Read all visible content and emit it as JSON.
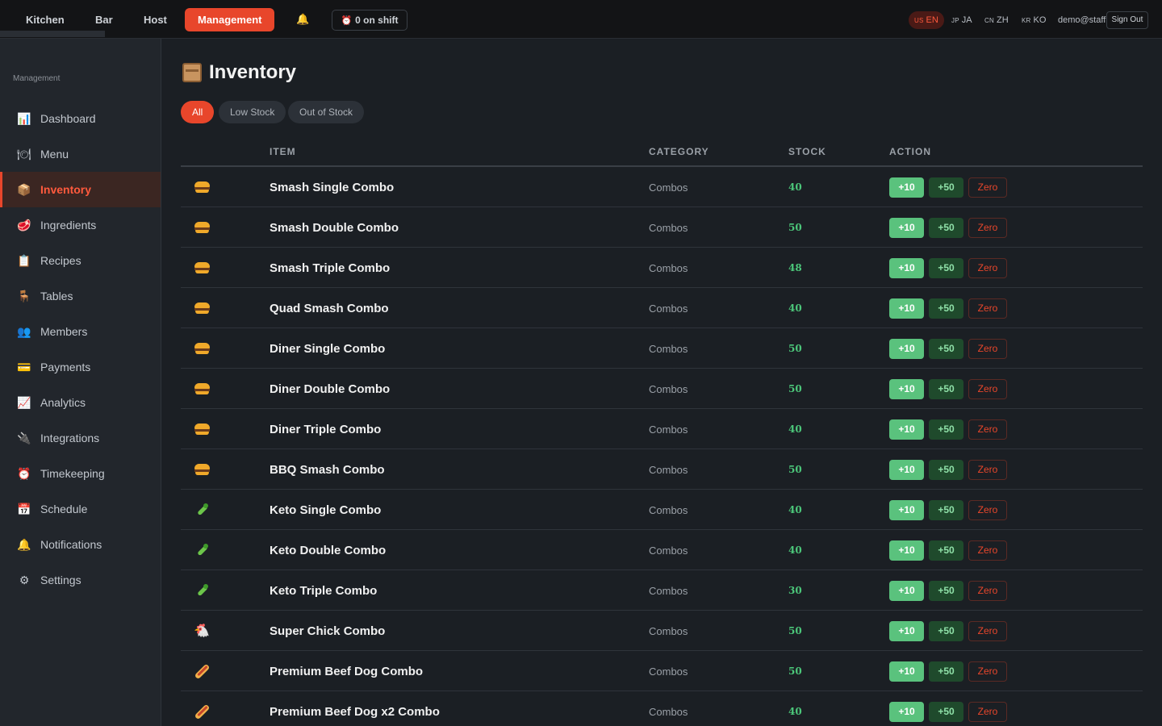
{
  "topnav": {
    "tabs": [
      {
        "label": "Kitchen"
      },
      {
        "label": "Bar"
      },
      {
        "label": "Host"
      },
      {
        "label": "Management"
      }
    ],
    "shift_label": "0 on shift",
    "languages": [
      {
        "code": "US",
        "label": "EN"
      },
      {
        "code": "JP",
        "label": "JA"
      },
      {
        "code": "CN",
        "label": "ZH"
      },
      {
        "code": "KR",
        "label": "KO"
      }
    ],
    "active_language": "EN",
    "user": "demo@staff",
    "signout_label": "Sign Out"
  },
  "sidebar": {
    "section_label": "Management",
    "items": [
      {
        "label": "Dashboard",
        "icon": "bar-chart-icon"
      },
      {
        "label": "Menu",
        "icon": "plate-icon"
      },
      {
        "label": "Inventory",
        "icon": "package-icon"
      },
      {
        "label": "Ingredients",
        "icon": "meat-icon"
      },
      {
        "label": "Recipes",
        "icon": "clipboard-icon"
      },
      {
        "label": "Tables",
        "icon": "chair-icon"
      },
      {
        "label": "Members",
        "icon": "people-icon"
      },
      {
        "label": "Payments",
        "icon": "credit-card-icon"
      },
      {
        "label": "Analytics",
        "icon": "trend-chart-icon"
      },
      {
        "label": "Integrations",
        "icon": "plug-icon"
      },
      {
        "label": "Timekeeping",
        "icon": "alarm-clock-icon"
      },
      {
        "label": "Schedule",
        "icon": "calendar-icon"
      },
      {
        "label": "Notifications",
        "icon": "bell-icon"
      },
      {
        "label": "Settings",
        "icon": "gear-icon"
      }
    ],
    "active_item": "Inventory"
  },
  "page": {
    "title": "Inventory",
    "filters": [
      {
        "label": "All"
      },
      {
        "label": "Low Stock"
      },
      {
        "label": "Out of Stock"
      }
    ],
    "active_filter": "All"
  },
  "table": {
    "columns": [
      "ITEM",
      "CATEGORY",
      "STOCK",
      "ACTION"
    ],
    "action_labels": {
      "add10": "+10",
      "add50": "+50",
      "zero": "Zero"
    },
    "rows": [
      {
        "icon": "burger-icon",
        "name": "Smash Single Combo",
        "category": "Combos",
        "stock": "40"
      },
      {
        "icon": "burger-icon",
        "name": "Smash Double Combo",
        "category": "Combos",
        "stock": "50"
      },
      {
        "icon": "burger-icon",
        "name": "Smash Triple Combo",
        "category": "Combos",
        "stock": "48"
      },
      {
        "icon": "burger-icon",
        "name": "Quad Smash Combo",
        "category": "Combos",
        "stock": "40"
      },
      {
        "icon": "burger-icon",
        "name": "Diner Single Combo",
        "category": "Combos",
        "stock": "50"
      },
      {
        "icon": "burger-icon",
        "name": "Diner Double Combo",
        "category": "Combos",
        "stock": "50"
      },
      {
        "icon": "burger-icon",
        "name": "Diner Triple Combo",
        "category": "Combos",
        "stock": "40"
      },
      {
        "icon": "burger-icon",
        "name": "BBQ Smash Combo",
        "category": "Combos",
        "stock": "50"
      },
      {
        "icon": "celery-icon",
        "name": "Keto Single Combo",
        "category": "Combos",
        "stock": "40"
      },
      {
        "icon": "celery-icon",
        "name": "Keto Double Combo",
        "category": "Combos",
        "stock": "40"
      },
      {
        "icon": "celery-icon",
        "name": "Keto Triple Combo",
        "category": "Combos",
        "stock": "30"
      },
      {
        "icon": "chicken-icon",
        "name": "Super Chick Combo",
        "category": "Combos",
        "stock": "50"
      },
      {
        "icon": "hotdog-icon",
        "name": "Premium Beef Dog Combo",
        "category": "Combos",
        "stock": "50"
      },
      {
        "icon": "hotdog-icon",
        "name": "Premium Beef Dog x2 Combo",
        "category": "Combos",
        "stock": "40"
      }
    ]
  },
  "colors": {
    "accent": "#e8462b",
    "stock_green": "#4cc77a",
    "background": "#1b1f24",
    "sidebar": "#22262c"
  }
}
